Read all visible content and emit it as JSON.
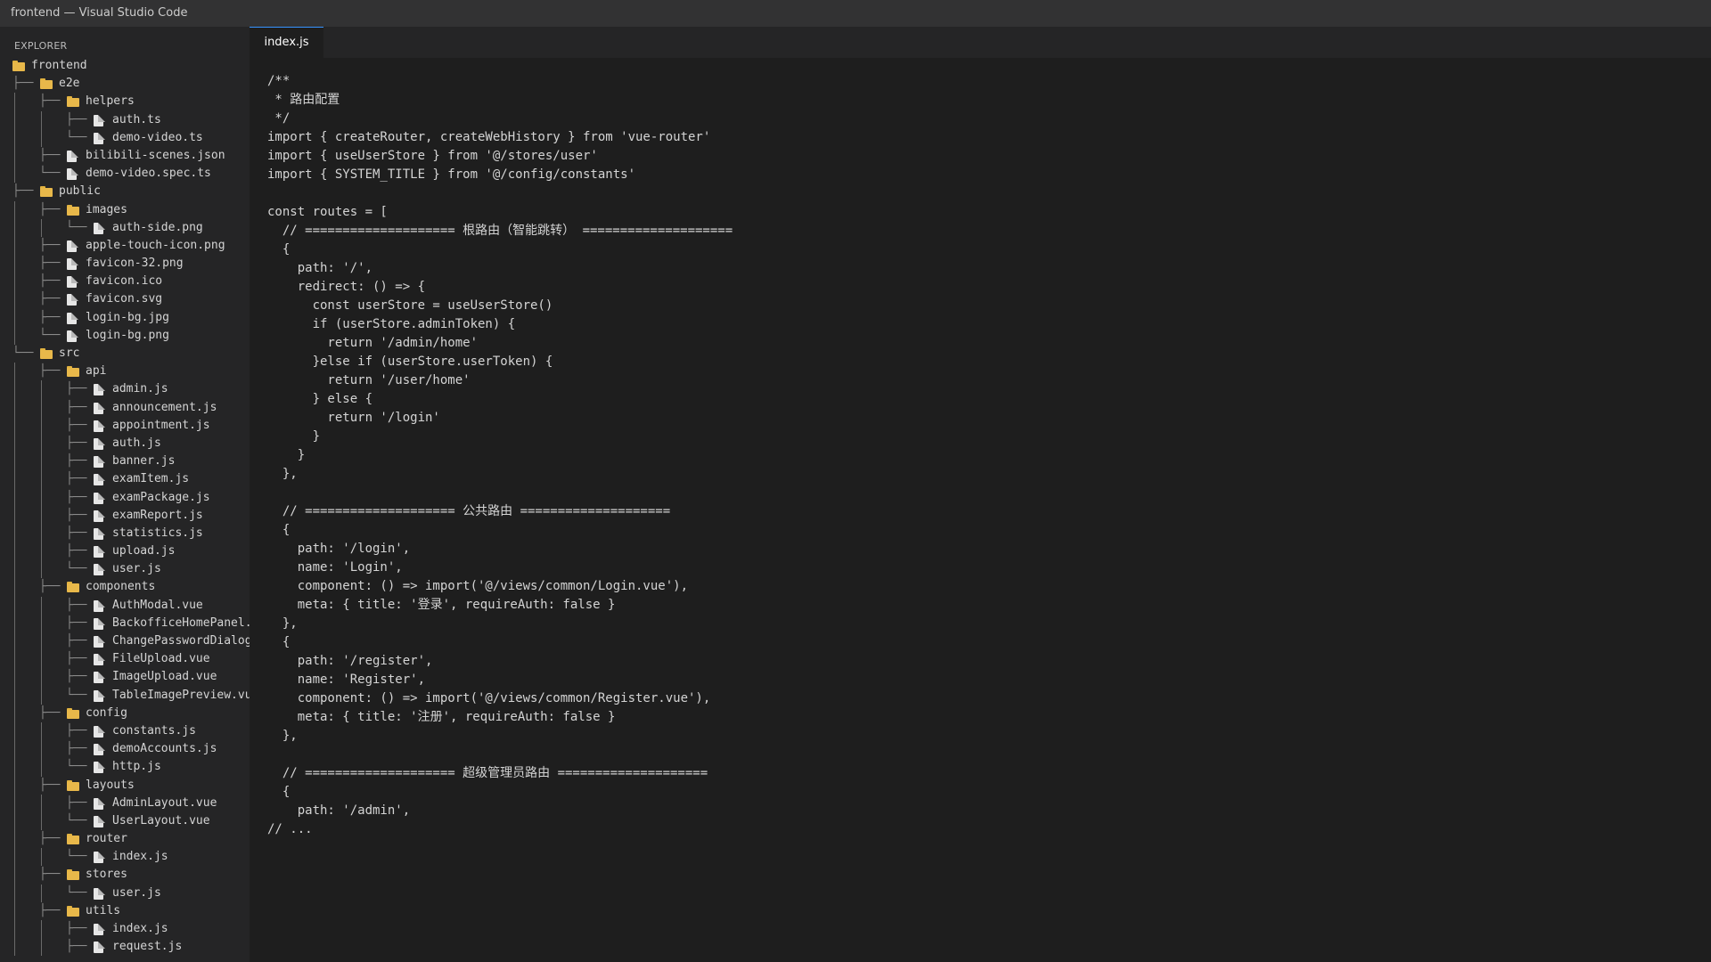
{
  "window": {
    "title": "frontend — Visual Studio Code"
  },
  "explorer": {
    "title": "EXPLORER",
    "tree": [
      {
        "depth": 0,
        "type": "folder",
        "name": "frontend",
        "prefix": ""
      },
      {
        "depth": 1,
        "type": "folder",
        "name": "e2e",
        "prefix": "├──"
      },
      {
        "depth": 2,
        "type": "folder",
        "name": "helpers",
        "prefix": "├──"
      },
      {
        "depth": 3,
        "type": "file",
        "name": "auth.ts",
        "prefix": "├──"
      },
      {
        "depth": 3,
        "type": "file",
        "name": "demo-video.ts",
        "prefix": "└──"
      },
      {
        "depth": 2,
        "type": "file",
        "name": "bilibili-scenes.json",
        "prefix": "├──"
      },
      {
        "depth": 2,
        "type": "file",
        "name": "demo-video.spec.ts",
        "prefix": "└──"
      },
      {
        "depth": 1,
        "type": "folder",
        "name": "public",
        "prefix": "├──"
      },
      {
        "depth": 2,
        "type": "folder",
        "name": "images",
        "prefix": "├──"
      },
      {
        "depth": 3,
        "type": "file",
        "name": "auth-side.png",
        "prefix": "└──"
      },
      {
        "depth": 2,
        "type": "file",
        "name": "apple-touch-icon.png",
        "prefix": "├──"
      },
      {
        "depth": 2,
        "type": "file",
        "name": "favicon-32.png",
        "prefix": "├──"
      },
      {
        "depth": 2,
        "type": "file",
        "name": "favicon.ico",
        "prefix": "├──"
      },
      {
        "depth": 2,
        "type": "file",
        "name": "favicon.svg",
        "prefix": "├──"
      },
      {
        "depth": 2,
        "type": "file",
        "name": "login-bg.jpg",
        "prefix": "├──"
      },
      {
        "depth": 2,
        "type": "file",
        "name": "login-bg.png",
        "prefix": "└──"
      },
      {
        "depth": 1,
        "type": "folder",
        "name": "src",
        "prefix": "└──"
      },
      {
        "depth": 2,
        "type": "folder",
        "name": "api",
        "prefix": "├──"
      },
      {
        "depth": 3,
        "type": "file",
        "name": "admin.js",
        "prefix": "├──"
      },
      {
        "depth": 3,
        "type": "file",
        "name": "announcement.js",
        "prefix": "├──"
      },
      {
        "depth": 3,
        "type": "file",
        "name": "appointment.js",
        "prefix": "├──"
      },
      {
        "depth": 3,
        "type": "file",
        "name": "auth.js",
        "prefix": "├──"
      },
      {
        "depth": 3,
        "type": "file",
        "name": "banner.js",
        "prefix": "├──"
      },
      {
        "depth": 3,
        "type": "file",
        "name": "examItem.js",
        "prefix": "├──"
      },
      {
        "depth": 3,
        "type": "file",
        "name": "examPackage.js",
        "prefix": "├──"
      },
      {
        "depth": 3,
        "type": "file",
        "name": "examReport.js",
        "prefix": "├──"
      },
      {
        "depth": 3,
        "type": "file",
        "name": "statistics.js",
        "prefix": "├──"
      },
      {
        "depth": 3,
        "type": "file",
        "name": "upload.js",
        "prefix": "├──"
      },
      {
        "depth": 3,
        "type": "file",
        "name": "user.js",
        "prefix": "└──"
      },
      {
        "depth": 2,
        "type": "folder",
        "name": "components",
        "prefix": "├──"
      },
      {
        "depth": 3,
        "type": "file",
        "name": "AuthModal.vue",
        "prefix": "├──"
      },
      {
        "depth": 3,
        "type": "file",
        "name": "BackofficeHomePanel.",
        "prefix": "├──"
      },
      {
        "depth": 3,
        "type": "file",
        "name": "ChangePasswordDialog",
        "prefix": "├──"
      },
      {
        "depth": 3,
        "type": "file",
        "name": "FileUpload.vue",
        "prefix": "├──"
      },
      {
        "depth": 3,
        "type": "file",
        "name": "ImageUpload.vue",
        "prefix": "├──"
      },
      {
        "depth": 3,
        "type": "file",
        "name": "TableImagePreview.vu",
        "prefix": "└──"
      },
      {
        "depth": 2,
        "type": "folder",
        "name": "config",
        "prefix": "├──"
      },
      {
        "depth": 3,
        "type": "file",
        "name": "constants.js",
        "prefix": "├──"
      },
      {
        "depth": 3,
        "type": "file",
        "name": "demoAccounts.js",
        "prefix": "├──"
      },
      {
        "depth": 3,
        "type": "file",
        "name": "http.js",
        "prefix": "└──"
      },
      {
        "depth": 2,
        "type": "folder",
        "name": "layouts",
        "prefix": "├──"
      },
      {
        "depth": 3,
        "type": "file",
        "name": "AdminLayout.vue",
        "prefix": "├──"
      },
      {
        "depth": 3,
        "type": "file",
        "name": "UserLayout.vue",
        "prefix": "└──"
      },
      {
        "depth": 2,
        "type": "folder",
        "name": "router",
        "prefix": "├──"
      },
      {
        "depth": 3,
        "type": "file",
        "name": "index.js",
        "prefix": "└──"
      },
      {
        "depth": 2,
        "type": "folder",
        "name": "stores",
        "prefix": "├──"
      },
      {
        "depth": 3,
        "type": "file",
        "name": "user.js",
        "prefix": "└──"
      },
      {
        "depth": 2,
        "type": "folder",
        "name": "utils",
        "prefix": "├──"
      },
      {
        "depth": 3,
        "type": "file",
        "name": "index.js",
        "prefix": "├──"
      },
      {
        "depth": 3,
        "type": "file",
        "name": "request.js",
        "prefix": "├──"
      }
    ]
  },
  "tabs": [
    {
      "label": "index.js",
      "active": true
    }
  ],
  "editor": {
    "lines": [
      "/**",
      " * 路由配置",
      " */",
      "import { createRouter, createWebHistory } from 'vue-router'",
      "import { useUserStore } from '@/stores/user'",
      "import { SYSTEM_TITLE } from '@/config/constants'",
      "",
      "const routes = [",
      "  // ==================== 根路由（智能跳转） ====================",
      "  {",
      "    path: '/',",
      "    redirect: () => {",
      "      const userStore = useUserStore()",
      "      if (userStore.adminToken) {",
      "        return '/admin/home'",
      "      }else if (userStore.userToken) {",
      "        return '/user/home'",
      "      } else {",
      "        return '/login'",
      "      }",
      "    }",
      "  },",
      "",
      "  // ==================== 公共路由 ====================",
      "  {",
      "    path: '/login',",
      "    name: 'Login',",
      "    component: () => import('@/views/common/Login.vue'),",
      "    meta: { title: '登录', requireAuth: false }",
      "  },",
      "  {",
      "    path: '/register',",
      "    name: 'Register',",
      "    component: () => import('@/views/common/Register.vue'),",
      "    meta: { title: '注册', requireAuth: false }",
      "  },",
      "",
      "  // ==================== 超级管理员路由 ====================",
      "  {",
      "    path: '/admin',",
      "// ..."
    ]
  },
  "colors": {
    "background": "#1e1e1e",
    "sidebar": "#252526",
    "titlebar": "#323233",
    "accent": "#3794ff",
    "text": "#d4d4d4",
    "folder": "#e8b84a",
    "file": "#e6e6e6"
  }
}
